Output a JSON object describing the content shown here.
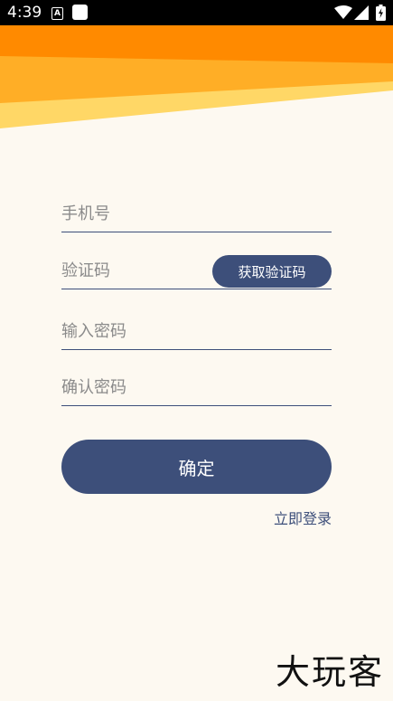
{
  "status_bar": {
    "time": "4:39",
    "notification_letter": "A",
    "icons": [
      "notification-a-icon",
      "notification-square-icon",
      "wifi-icon",
      "signal-icon",
      "battery-icon"
    ]
  },
  "colors": {
    "background": "#fdf9f1",
    "primary": "#3d4f7a",
    "banner_dark_orange": "#ff8a00",
    "banner_orange": "#ffae26",
    "banner_light": "#ffd766"
  },
  "form": {
    "phone_placeholder": "手机号",
    "code_placeholder": "验证码",
    "get_code_label": "获取验证码",
    "password_placeholder": "输入密码",
    "confirm_password_placeholder": "确认密码",
    "confirm_label": "确定",
    "login_link": "立即登录"
  },
  "watermark": "大玩客"
}
